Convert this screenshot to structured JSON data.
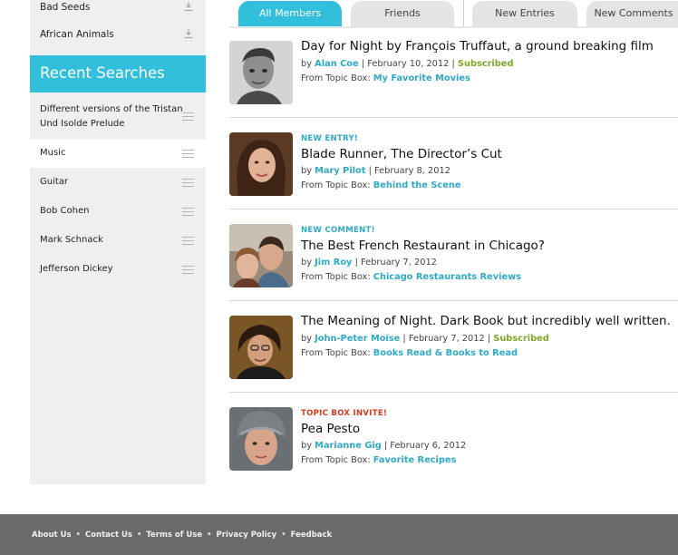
{
  "sidebar": {
    "top_items": [
      {
        "label": "Bad Seeds",
        "icon": "download-icon"
      },
      {
        "label": "African Animals",
        "icon": "download-icon"
      }
    ],
    "recent_searches_title": "Recent Searches",
    "searches": [
      {
        "label": "Different versions of the Tristan Und Isolde Prelude",
        "icon": "menu-lines-icon"
      },
      {
        "label": "Music",
        "icon": "menu-lines-icon",
        "active": true
      },
      {
        "label": "Guitar",
        "icon": "menu-lines-icon"
      },
      {
        "label": "Bob Cohen",
        "icon": "menu-lines-icon"
      },
      {
        "label": "Mark Schnack",
        "icon": "menu-lines-icon"
      },
      {
        "label": "Jefferson Dickey",
        "icon": "menu-lines-icon"
      }
    ]
  },
  "tabs": [
    {
      "label": "All Members",
      "active": true
    },
    {
      "label": "Friends"
    },
    {
      "label": "New Entries"
    },
    {
      "label": "New Comments"
    }
  ],
  "feed": [
    {
      "tag": "",
      "title": "Day for Night by François Truffaut, a ground breaking film",
      "by": "by",
      "author": "Alan Coe",
      "date": "February 10, 2012",
      "status": "Subscribed",
      "topic_prefix": "From Topic Box:",
      "topic": "My Favorite Movies"
    },
    {
      "tag": "NEW ENTRY!",
      "title": "Blade Runner, The Director’s Cut",
      "by": "by",
      "author": "Mary Pilot",
      "date": "February 8, 2012",
      "status": "",
      "topic_prefix": "From Topic Box:",
      "topic": "Behind the Scene"
    },
    {
      "tag": "NEW COMMENT!",
      "title": "The Best French Restaurant in Chicago?",
      "by": "by",
      "author": "Jim Roy",
      "date": "February 7, 2012",
      "status": "",
      "topic_prefix": "From Topic Box:",
      "topic": "Chicago Restaurants Reviews"
    },
    {
      "tag": "",
      "title": "The Meaning of Night. Dark Book but incredibly well written.",
      "by": "by",
      "author": "John-Peter Moïse",
      "date": "February 7, 2012",
      "status": "Subscribed",
      "topic_prefix": "From Topic Box:",
      "topic": "Books Read & Books to Read"
    },
    {
      "tag": "TOPIC BOX INVITE!",
      "title": "Pea Pesto",
      "by": "by",
      "author": "Marianne Gig",
      "date": "February 6, 2012",
      "status": "",
      "topic_prefix": "From Topic Box:",
      "topic": "Favorite Recipes"
    }
  ],
  "footer": {
    "links": [
      "About Us",
      "Contact Us",
      "Terms of Use",
      "Privacy Policy",
      "Feedback"
    ],
    "separator": "•"
  },
  "colors": {
    "accent": "#31bfdb",
    "link": "#2fa9c6",
    "subscribed": "#7da829",
    "tag_cyan": "#2fa9c6",
    "tag_red": "#d63a1e",
    "footer_bg": "#6a6a6a"
  }
}
